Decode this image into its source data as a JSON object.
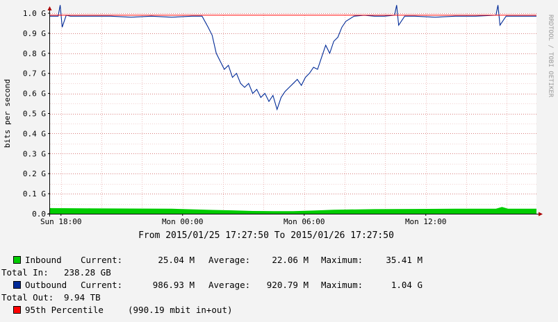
{
  "chart_data": {
    "type": "area",
    "ylabel": "bits per second",
    "watermark": "RRDTOOL / TOBI OETIKER",
    "y_unit": "bits per second",
    "ylim": [
      0,
      1000000000.0
    ],
    "y_ticks": [
      {
        "value": 0.0,
        "label": "0.0"
      },
      {
        "value": 100000000.0,
        "label": "0.1 G"
      },
      {
        "value": 200000000.0,
        "label": "0.2 G"
      },
      {
        "value": 300000000.0,
        "label": "0.3 G"
      },
      {
        "value": 400000000.0,
        "label": "0.4 G"
      },
      {
        "value": 500000000.0,
        "label": "0.5 G"
      },
      {
        "value": 600000000.0,
        "label": "0.6 G"
      },
      {
        "value": 700000000.0,
        "label": "0.7 G"
      },
      {
        "value": 800000000.0,
        "label": "0.8 G"
      },
      {
        "value": 900000000.0,
        "label": "0.9 G"
      },
      {
        "value": 1000000000.0,
        "label": "1.0 G"
      }
    ],
    "x_range_hours": [
      0,
      24
    ],
    "x_ticks": [
      {
        "hour": 0.54,
        "label": "Sun 18:00"
      },
      {
        "hour": 6.54,
        "label": "Mon 00:00"
      },
      {
        "hour": 12.54,
        "label": "Mon 06:00"
      },
      {
        "hour": 18.54,
        "label": "Mon 12:00"
      }
    ],
    "x_grid_hours": [
      0.54,
      2.54,
      4.54,
      6.54,
      8.54,
      10.54,
      12.54,
      14.54,
      16.54,
      18.54,
      20.54,
      22.54
    ],
    "percentile_95": 990190000.0,
    "series": [
      {
        "name": "Inbound",
        "color": "#00cc00",
        "x": [
          0,
          2,
          4,
          6,
          8,
          9,
          10,
          11,
          12,
          13,
          14,
          16,
          18,
          20,
          22,
          22.3,
          22.6,
          24
        ],
        "values": [
          28000000.0,
          27000000.0,
          26000000.0,
          25000000.0,
          19000000.0,
          17000000.0,
          14000000.0,
          13000000.0,
          13000000.0,
          16000000.0,
          20000000.0,
          23000000.0,
          24000000.0,
          25000000.0,
          25000000.0,
          34000000.0,
          25000000.0,
          25000000.0
        ]
      },
      {
        "name": "Outbound",
        "color": "#002a97",
        "x": [
          0,
          0.4,
          0.5,
          0.6,
          0.8,
          1,
          2,
          3,
          4,
          5,
          6,
          7,
          7.5,
          7.8,
          8.0,
          8.2,
          8.4,
          8.6,
          8.8,
          9.0,
          9.2,
          9.4,
          9.6,
          9.8,
          10.0,
          10.2,
          10.4,
          10.6,
          10.8,
          11.0,
          11.2,
          11.4,
          11.6,
          11.8,
          12.0,
          12.2,
          12.4,
          12.6,
          12.8,
          13.0,
          13.2,
          13.4,
          13.6,
          13.8,
          14.0,
          14.2,
          14.4,
          14.6,
          15,
          15.5,
          16,
          16.5,
          17,
          17.1,
          17.2,
          17.5,
          18,
          19,
          20,
          21,
          22,
          22.1,
          22.2,
          22.5,
          23,
          24
        ],
        "values": [
          985000000.0,
          985000000.0,
          1040000000.0,
          930000000.0,
          990000000.0,
          985000000.0,
          985000000.0,
          985000000.0,
          980000000.0,
          985000000.0,
          980000000.0,
          985000000.0,
          985000000.0,
          930000000.0,
          890000000.0,
          800000000.0,
          760000000.0,
          720000000.0,
          740000000.0,
          680000000.0,
          700000000.0,
          650000000.0,
          630000000.0,
          650000000.0,
          600000000.0,
          620000000.0,
          580000000.0,
          600000000.0,
          560000000.0,
          590000000.0,
          520000000.0,
          580000000.0,
          610000000.0,
          630000000.0,
          650000000.0,
          670000000.0,
          640000000.0,
          680000000.0,
          700000000.0,
          730000000.0,
          720000000.0,
          780000000.0,
          840000000.0,
          800000000.0,
          860000000.0,
          880000000.0,
          930000000.0,
          960000000.0,
          985000000.0,
          990000000.0,
          985000000.0,
          985000000.0,
          990000000.0,
          1040000000.0,
          940000000.0,
          985000000.0,
          985000000.0,
          980000000.0,
          985000000.0,
          985000000.0,
          990000000.0,
          1040000000.0,
          940000000.0,
          985000000.0,
          985000000.0,
          985000000.0
        ]
      }
    ],
    "range_text": "From 2015/01/25 17:27:50 To 2015/01/26 17:27:50"
  },
  "legend": {
    "inbound": {
      "color": "#00cc00",
      "name": "Inbound",
      "current_label": "Current:",
      "current": "25.04 M",
      "average_label": "Average:",
      "average": "22.06 M",
      "maximum_label": "Maximum:",
      "maximum": "35.41 M",
      "total_label": "Total In:",
      "total": "238.28 GB"
    },
    "outbound": {
      "color": "#002a97",
      "name": "Outbound",
      "current_label": "Current:",
      "current": "986.93 M",
      "average_label": "Average:",
      "average": "920.79 M",
      "maximum_label": "Maximum:",
      "maximum": "1.04 G",
      "total_label": "Total Out:",
      "total": "9.94 TB"
    },
    "percentile": {
      "color": "#ff0000",
      "name": "95th Percentile",
      "detail": "(990.19 mbit in+out)"
    }
  }
}
